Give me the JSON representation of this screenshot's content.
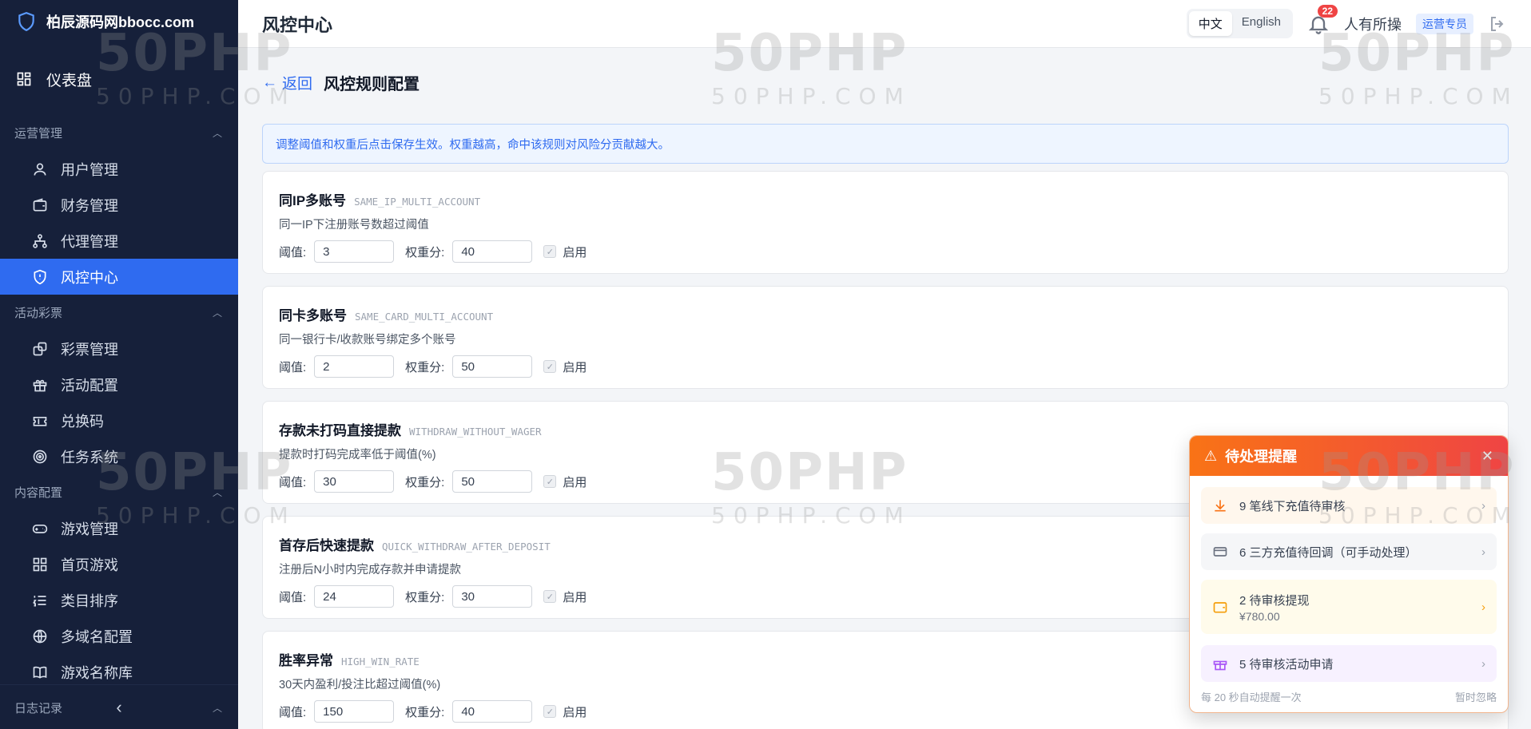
{
  "brand": {
    "name": "柏辰源码网bbocc.com"
  },
  "sidebar": {
    "dashboard": "仪表盘",
    "groups": [
      {
        "title": "运营管理",
        "items": [
          "用户管理",
          "财务管理",
          "代理管理",
          "风控中心"
        ]
      },
      {
        "title": "活动彩票",
        "items": [
          "彩票管理",
          "活动配置",
          "兑换码",
          "任务系统"
        ]
      },
      {
        "title": "内容配置",
        "items": [
          "游戏管理",
          "首页游戏",
          "类目排序",
          "多域名配置",
          "游戏名称库"
        ]
      },
      {
        "title": "日志记录",
        "items": []
      }
    ],
    "active": "风控中心",
    "collapse_icon": "‹"
  },
  "header": {
    "title": "风控中心",
    "lang": [
      "中文",
      "English"
    ],
    "lang_active": "中文",
    "notifications": "22",
    "user": "人有所操",
    "role": "运营专员"
  },
  "page": {
    "back": "返回",
    "title": "风控规则配置",
    "notice": "调整阈值和权重后点击保存生效。权重越高，命中该规则对风险分贡献越大。",
    "threshold_label": "阈值:",
    "weight_label": "权重分:",
    "enabled_label": "启用"
  },
  "rules": [
    {
      "name": "同IP多账号",
      "code": "SAME_IP_MULTI_ACCOUNT",
      "desc": "同一IP下注册账号数超过阈值",
      "threshold": "3",
      "weight": "40"
    },
    {
      "name": "同卡多账号",
      "code": "SAME_CARD_MULTI_ACCOUNT",
      "desc": "同一银行卡/收款账号绑定多个账号",
      "threshold": "2",
      "weight": "50"
    },
    {
      "name": "存款未打码直接提款",
      "code": "WITHDRAW_WITHOUT_WAGER",
      "desc": "提款时打码完成率低于阈值(%)",
      "threshold": "30",
      "weight": "50"
    },
    {
      "name": "首存后快速提款",
      "code": "QUICK_WITHDRAW_AFTER_DEPOSIT",
      "desc": "注册后N小时内完成存款并申请提款",
      "threshold": "24",
      "weight": "30"
    },
    {
      "name": "胜率异常",
      "code": "HIGH_WIN_RATE",
      "desc": "30天内盈利/投注比超过阈值(%)",
      "threshold": "150",
      "weight": "40"
    }
  ],
  "popup": {
    "title": "待处理提醒",
    "items": [
      {
        "text": "9 笔线下充值待审核",
        "icon": "download-icon"
      },
      {
        "text": "6 三方充值待回调（可手动处理）",
        "icon": "card-icon"
      },
      {
        "text": "2 待审核提现",
        "sub": "¥780.00",
        "icon": "wallet-icon"
      },
      {
        "text": "5 待审核活动申请",
        "icon": "gift-icon"
      }
    ],
    "footer_left": "每 20 秒自动提醒一次",
    "footer_right": "暂时忽略"
  },
  "watermark": {
    "big": "50PHP",
    "small": "50PHP.COM"
  },
  "colors": {
    "sidebar_bg": "#16203a",
    "accent": "#2f6bf0",
    "popup_header": "#f97316",
    "danger": "#ef4444"
  }
}
